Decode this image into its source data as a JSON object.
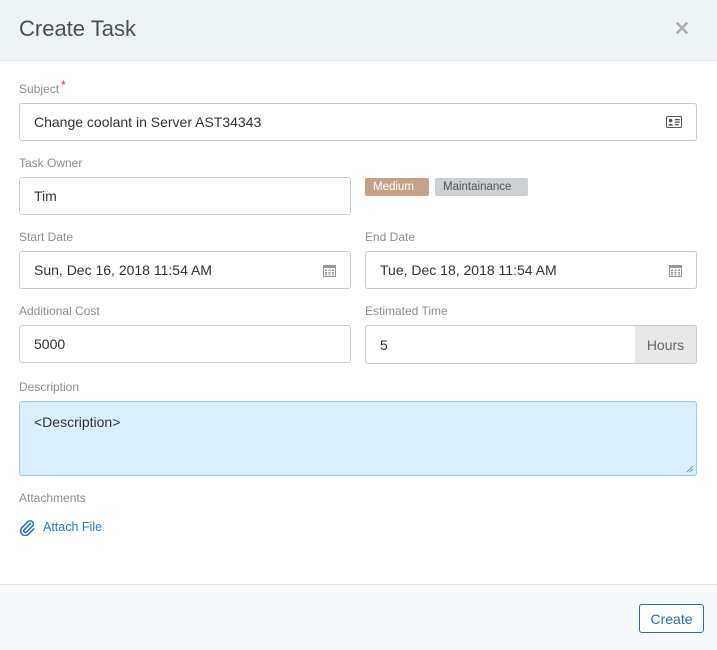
{
  "dialog": {
    "title": "Create Task",
    "close_icon": "close-icon"
  },
  "form": {
    "subject": {
      "label": "Subject",
      "required_mark": "*",
      "value": "Change coolant in Server AST34343",
      "icon": "contact-card-icon"
    },
    "task_owner": {
      "label": "Task Owner",
      "value": "Tim"
    },
    "tags": [
      {
        "label": "Medium",
        "color": "#c8a088"
      },
      {
        "label": "Maintainance",
        "color": "#cdd0d2"
      }
    ],
    "start_date": {
      "label": "Start Date",
      "value": "Sun, Dec 16, 2018 11:54 AM",
      "icon": "calendar-icon"
    },
    "end_date": {
      "label": "End Date",
      "value": "Tue, Dec 18, 2018 11:54 AM",
      "icon": "calendar-icon"
    },
    "additional_cost": {
      "label": "Additional Cost",
      "value": "5000"
    },
    "estimated_time": {
      "label": "Estimated Time",
      "value": "5",
      "unit": "Hours"
    },
    "description": {
      "label": "Description",
      "value": "<Description>"
    },
    "attachments": {
      "label": "Attachments",
      "action_label": "Attach File",
      "icon": "paperclip-icon"
    }
  },
  "footer": {
    "create_label": "Create"
  },
  "colors": {
    "accent": "#2b6cb0",
    "link": "#2b78c9",
    "description_bg": "#d9effc"
  }
}
